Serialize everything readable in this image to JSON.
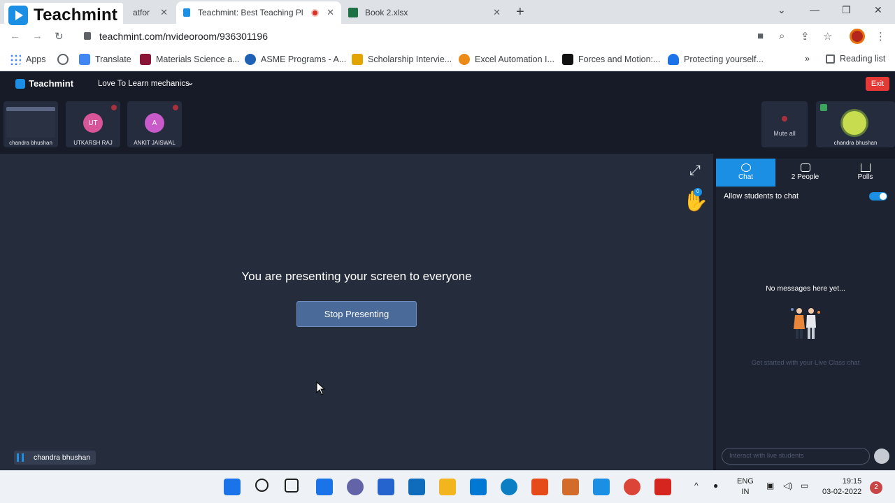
{
  "browser": {
    "watermark_text": "Teachmint",
    "tabs": [
      {
        "title": "atfor",
        "active": false
      },
      {
        "title": "Teachmint: Best Teaching Pla",
        "active": true
      },
      {
        "title": "Book 2.xlsx",
        "active": false
      }
    ],
    "url": "teachmint.com/nvideoroom/936301196",
    "bookmarks": [
      {
        "label": "Apps",
        "icon": "apps-grid-icon",
        "color": "#4285f4"
      },
      {
        "label": "",
        "icon": "globe-icon",
        "color": "#5f6368"
      },
      {
        "label": "Translate",
        "icon": "translate-icon",
        "color": "#4285f4"
      },
      {
        "label": "Materials Science a...",
        "icon": "mit-icon",
        "color": "#8a1538"
      },
      {
        "label": "ASME Programs - A...",
        "icon": "asme-icon",
        "color": "#1f62b5"
      },
      {
        "label": "Scholarship Intervie...",
        "icon": "graduation-cap-icon",
        "color": "#e2a400"
      },
      {
        "label": "Excel Automation I...",
        "icon": "udemy-icon",
        "color": "#ec8a18"
      },
      {
        "label": "Forces and Motion:...",
        "icon": "phet-icon",
        "color": "#111111"
      },
      {
        "label": "Protecting yourself...",
        "icon": "shield-icon",
        "color": "#1a73e8"
      }
    ],
    "more_bookmarks": "»",
    "reading_list": "Reading list"
  },
  "app": {
    "brand": "Teachmint",
    "class_name": "Love To Learn mechanics",
    "exit_label": "Exit",
    "participants": [
      {
        "name": "chandra bhushan",
        "initials": "",
        "kind": "screen"
      },
      {
        "name": "UTKARSH RAJ",
        "initials": "UT",
        "color": "#d9559a"
      },
      {
        "name": "ANKIT JAISWAL",
        "initials": "A",
        "color": "#c85bc9"
      }
    ],
    "mute_all_label": "Mute all",
    "self_name": "chandra bhushan",
    "hand_count": "0",
    "presenting_text": "You are presenting your screen to everyone",
    "stop_presenting_label": "Stop Presenting",
    "active_speaker": "chandra bhushan",
    "side_tabs": [
      {
        "label": "Chat",
        "active": true
      },
      {
        "label": "2 People",
        "active": false
      },
      {
        "label": "Polls",
        "active": false
      }
    ],
    "allow_chat_label": "Allow students to chat",
    "allow_chat_enabled": true,
    "no_messages": "No messages here yet...",
    "get_started": "Get started with your Live Class chat",
    "chat_placeholder": "Interact with live students"
  },
  "taskbar": {
    "lang_line1": "ENG",
    "lang_line2": "IN",
    "time": "19:15",
    "date": "03-02-2022",
    "notifications": "2",
    "apps": [
      {
        "name": "windows-start-icon",
        "color": "#1a73e8"
      },
      {
        "name": "search-icon",
        "color": "#1f1f1f"
      },
      {
        "name": "task-view-icon",
        "color": "#1f1f1f"
      },
      {
        "name": "widgets-icon",
        "color": "#1a73e8"
      },
      {
        "name": "teams-chat-icon",
        "color": "#6264a7"
      },
      {
        "name": "todo-icon",
        "color": "#2564cf"
      },
      {
        "name": "mail-icon",
        "color": "#0f6cbd"
      },
      {
        "name": "file-explorer-icon",
        "color": "#f2b51d"
      },
      {
        "name": "store-icon",
        "color": "#0078d4"
      },
      {
        "name": "edge-icon",
        "color": "#0c7fc4"
      },
      {
        "name": "office-icon",
        "color": "#e64a19"
      },
      {
        "name": "snipping-tool-icon",
        "color": "#d36b2b"
      },
      {
        "name": "teachmint-app-icon",
        "color": "#1a8fe3"
      },
      {
        "name": "chrome-icon",
        "color": "#db4437"
      },
      {
        "name": "acrobat-icon",
        "color": "#d4261f"
      }
    ]
  }
}
